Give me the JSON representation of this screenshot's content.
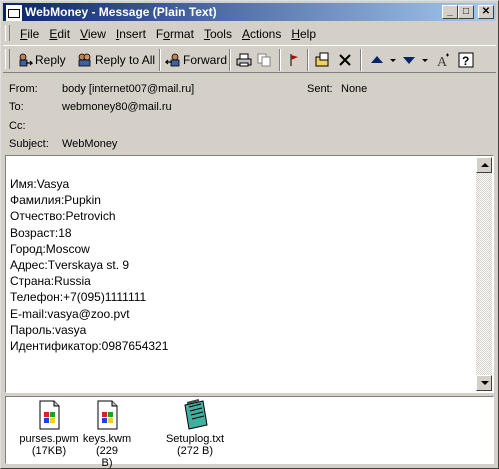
{
  "window": {
    "title": "WebMoney - Message (Plain Text)"
  },
  "menu": [
    "File",
    "Edit",
    "View",
    "Insert",
    "Format",
    "Tools",
    "Actions",
    "Help"
  ],
  "menu_underline": [
    "F",
    "E",
    "V",
    "I",
    "o",
    "T",
    "A",
    "H"
  ],
  "toolbar": {
    "reply": "Reply",
    "reply_all": "Reply to All",
    "forward": "Forward"
  },
  "headers": {
    "from_label": "From:",
    "from_value": "body [internet007@mail.ru]",
    "sent_label": "Sent:",
    "sent_value": "None",
    "to_label": "To:",
    "to_value": "webmoney80@mail.ru",
    "cc_label": "Cc:",
    "cc_value": "",
    "subject_label": "Subject:",
    "subject_value": "WebMoney"
  },
  "body_lines": [
    "Имя:Vasya",
    "Фамилия:Pupkin",
    "Отчество:Petrovich",
    "Возраст:18",
    "Город:Moscow",
    "Адрес:Tverskaya st. 9",
    "Страна:Russia",
    "Телефон:+7(095)1111111",
    "E-mail:vasya@zoo.pvt",
    "Пароль:vasya",
    "Идентификатор:0987654321"
  ],
  "attachments": [
    {
      "name": "purses.pwm",
      "size": "(17KB)",
      "icon": "windows-file-icon"
    },
    {
      "name": "keys.kwm (229",
      "size": "B)",
      "icon": "windows-file-icon"
    },
    {
      "name": "Setuplog.txt",
      "size": "(272 B)",
      "icon": "notepad-icon"
    }
  ]
}
